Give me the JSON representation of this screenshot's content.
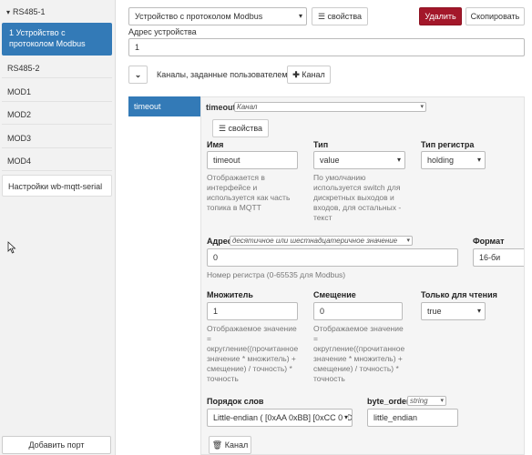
{
  "sidebar": {
    "header": "RS485-1",
    "active_item": "1 Устройство с протоколом Modbus",
    "items": [
      "RS485-2",
      "MOD1",
      "MOD2",
      "MOD3",
      "MOD4"
    ],
    "settings": "Настройки wb-mqtt-serial",
    "add_port": "Добавить порт"
  },
  "toolbar": {
    "device_type": "Устройство с протоколом Modbus",
    "properties": "свойства",
    "delete": "Удалить",
    "copy": "Скопировать"
  },
  "device": {
    "address_label": "Адрес устройства",
    "address_value": "1",
    "channels_label": "Каналы, заданные пользователем",
    "add_channel": "Канал"
  },
  "channel": {
    "tab": "timeout",
    "header_name": "timeout",
    "header_type": "Канал",
    "properties": "свойства",
    "name_label": "Имя",
    "name_value": "timeout",
    "name_help": "Отображается в интерфейсе и используется как часть топика в MQTT",
    "type_label": "Тип",
    "type_value": "value",
    "type_help": "По умолчанию используется switch для дискретных выходов и входов, для остальных - текст",
    "reg_type_label": "Тип регистра",
    "reg_type_value": "holding",
    "address_label": "Адрес",
    "address_hint": "десятичное или шестнадцатеричное значение",
    "address_value": "0",
    "address_help": "Номер регистра (0-65535 для Modbus)",
    "format_label": "Формат",
    "format_value": "16-би",
    "scale_label": "Множитель",
    "scale_value": "1",
    "scale_help": "Отображаемое значение = округление((прочитанное значение * множитель) + смещение) / точность) * точность",
    "offset_label": "Смещение",
    "offset_value": "0",
    "offset_help": "Отображаемое значение = округление((прочитанное значение * множитель) + смещение) / точность) * точность",
    "readonly_label": "Только для чтения",
    "readonly_value": "true",
    "word_order_label": "Порядок слов",
    "word_order_value": "Little-endian ( [0xAA 0xBB] [0xCC 0xD",
    "byte_order_label": "byte_order",
    "byte_order_type": "string",
    "byte_order_value": "little_endian",
    "delete_channel": "Канал"
  },
  "colors": {
    "primary": "#337ab7",
    "danger": "#a3172a"
  }
}
